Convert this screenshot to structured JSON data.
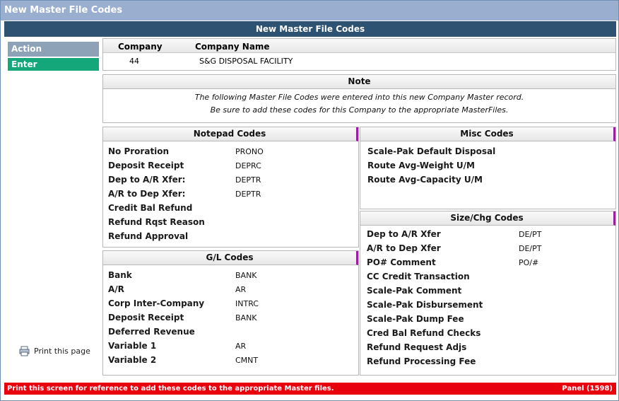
{
  "window": {
    "title": "New Master File Codes"
  },
  "header": {
    "title": "New Master File Codes"
  },
  "sidebar": {
    "action_label": "Action",
    "enter_label": "Enter",
    "print_label": "Print this page"
  },
  "company": {
    "col_company": "Company",
    "col_name": "Company Name",
    "company_no": "44",
    "company_name": "S&G DISPOSAL FACILITY"
  },
  "note": {
    "title": "Note",
    "line1": "The following Master File Codes were entered into this new Company Master record.",
    "line2": "Be sure to add these codes for this Company to the appropriate MasterFiles."
  },
  "notepad": {
    "title": "Notepad Codes",
    "rows": [
      {
        "label": "No Proration",
        "value": "PRONO"
      },
      {
        "label": "Deposit Receipt",
        "value": "DEPRC"
      },
      {
        "label": "Dep to A/R Xfer:",
        "value": "DEPTR"
      },
      {
        "label": "A/R to Dep Xfer:",
        "value": "DEPTR"
      },
      {
        "label": "Credit Bal Refund",
        "value": ""
      },
      {
        "label": "Refund Rqst Reason",
        "value": ""
      },
      {
        "label": "Refund Approval",
        "value": ""
      }
    ]
  },
  "gl": {
    "title": "G/L Codes",
    "rows": [
      {
        "label": "Bank",
        "value": "BANK"
      },
      {
        "label": "A/R",
        "value": "AR"
      },
      {
        "label": "Corp Inter-Company",
        "value": "INTRC"
      },
      {
        "label": "Deposit Receipt",
        "value": "BANK"
      },
      {
        "label": "Deferred Revenue",
        "value": ""
      },
      {
        "label": "Variable 1",
        "value": "AR"
      },
      {
        "label": "Variable 2",
        "value": "CMNT"
      }
    ]
  },
  "misc": {
    "title": "Misc Codes",
    "rows": [
      {
        "label": "Scale-Pak Default Disposal",
        "value": ""
      },
      {
        "label": "Route Avg-Weight U/M",
        "value": ""
      },
      {
        "label": "Route Avg-Capacity U/M",
        "value": ""
      }
    ]
  },
  "size": {
    "title": "Size/Chg Codes",
    "rows": [
      {
        "label": "Dep to A/R Xfer",
        "value": "DE/PT"
      },
      {
        "label": "A/R to Dep Xfer",
        "value": "DE/PT"
      },
      {
        "label": "PO# Comment",
        "value": "PO/#"
      },
      {
        "label": "CC Credit Transaction",
        "value": ""
      },
      {
        "label": "Scale-Pak Comment",
        "value": ""
      },
      {
        "label": "Scale-Pak Disbursement",
        "value": ""
      },
      {
        "label": "Scale-Pak Dump Fee",
        "value": ""
      },
      {
        "label": "Cred Bal Refund Checks",
        "value": ""
      },
      {
        "label": "Refund Request Adjs",
        "value": ""
      },
      {
        "label": "Refund Processing Fee",
        "value": ""
      }
    ]
  },
  "footer": {
    "message": "Print this screen for reference to add these codes to the appropriate Master files.",
    "panel": "Panel (1598)"
  }
}
